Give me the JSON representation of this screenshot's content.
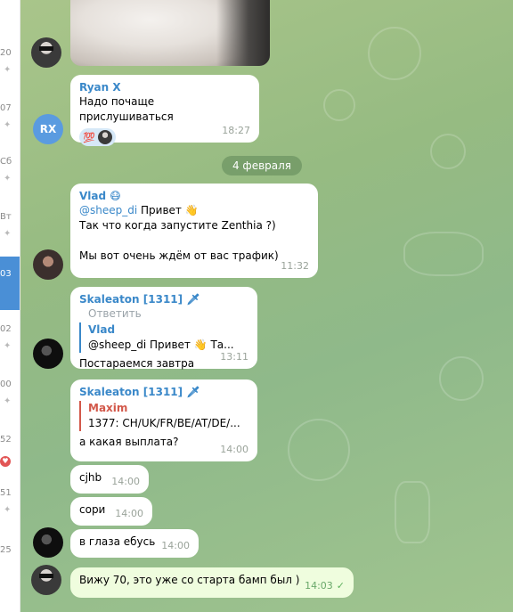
{
  "sidebar": {
    "entries": [
      {
        "label": "20"
      },
      {
        "label": "07"
      },
      {
        "label": "Сб"
      },
      {
        "label": "Вт"
      },
      {
        "label": "03"
      },
      {
        "label": "02"
      },
      {
        "label": "00"
      },
      {
        "label": "52"
      },
      {
        "label": "51"
      },
      {
        "label": "25"
      }
    ]
  },
  "date_separator": "4 февраля",
  "messages": [
    {
      "sender": "Ryan X",
      "avatar_initials": "RX",
      "text": "Надо почаще прислушиваться",
      "reaction_emoji": "💯",
      "time": "18:27"
    },
    {
      "sender": "Vlad",
      "sender_emoji": "😷",
      "mention": "@sheep_di",
      "text1": " Привет 👋",
      "text2": "Так что когда запустите Zenthia ?)",
      "text3": "Мы вот очень ждём от вас трафик)",
      "time": "11:32"
    },
    {
      "sender": "Skaleaton [1311]",
      "sender_emoji": "🗡",
      "reply_button": "Ответить",
      "reply_name": "Vlad",
      "reply_text": "@sheep_di Привет 👋 Та...",
      "text": "Постараемся завтра",
      "time": "13:11"
    },
    {
      "sender": "Skaleaton [1311]",
      "sender_emoji": "🗡",
      "reply_name": "Maxim",
      "reply_text": "1377: CH/UK/FR/BE/AT/DE/...",
      "text": "а какая выплата?",
      "time": "14:00"
    },
    {
      "text": "cjhb",
      "time": "14:00"
    },
    {
      "text": "сори",
      "time": "14:00"
    },
    {
      "text": "в глаза ебусь",
      "time": "14:00"
    },
    {
      "text": "Вижу 70, это уже со старта бамп был )",
      "time": "14:03",
      "check": "✓"
    }
  ]
}
